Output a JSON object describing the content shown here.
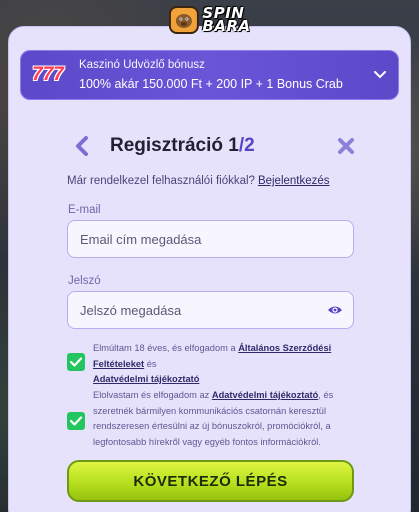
{
  "brand": {
    "line1": "SPIN",
    "line2": "BARA"
  },
  "bonus": {
    "badge": "777",
    "title": "Kaszinó Üdvözlő bónusz",
    "details": "100% akár 150.000 Ft + 200 IP + 1 Bonus Crab"
  },
  "header": {
    "title": "Regisztráció ",
    "step": "1",
    "total": "/2"
  },
  "account": {
    "question": "Már rendelkezel felhasználói fiókkal?",
    "login_link": "Bejelentkezés"
  },
  "email": {
    "label": "E-mail",
    "placeholder": "Email cím megadása"
  },
  "password": {
    "label": "Jelszó",
    "placeholder": "Jelszó megadása"
  },
  "terms": {
    "prefix": "Elmúltam 18 éves, és elfogadom a ",
    "link1": "Általános Szerződési Feltételeket",
    "mid": " és ",
    "link2": "Adatvédelmi tájékoztató"
  },
  "marketing": {
    "prefix": "Elolvastam és elfogadom az ",
    "link": "Adatvédelmi tájékoztató",
    "rest": ", és szeretnék bármilyen kommunikációs csatornán keresztül rendszeresen értesülni az új bónuszokról, promóciókról, a legfontosabb hírekről vagy egyéb fontos információkról."
  },
  "cta": {
    "label": "KÖVETKEZŐ LÉPÉS"
  },
  "colors": {
    "accent": "#5644c8",
    "check": "#22c55e",
    "cta": "#b6e01e"
  }
}
